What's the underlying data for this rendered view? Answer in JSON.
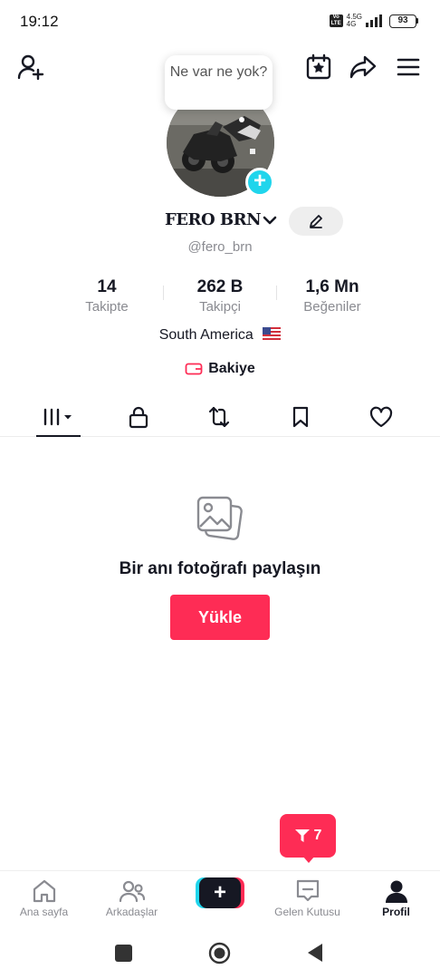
{
  "status_bar": {
    "time": "19:12",
    "volte": "Vo LTE",
    "network_top": "4.5G",
    "network_bottom": "4G",
    "battery": "93"
  },
  "header": {
    "add_friend_icon": "person-plus-icon",
    "calendar_icon": "calendar-star-icon",
    "share_icon": "share-arrow-icon",
    "menu_icon": "hamburger-menu-icon"
  },
  "profile": {
    "note_bubble": "Ne var ne yok?",
    "avatar_add": "+",
    "display_name": "FERO BRN",
    "username": "@fero_brn",
    "bio": "South America",
    "balance_label": "Bakiye"
  },
  "stats": [
    {
      "value": "14",
      "label": "Takipte"
    },
    {
      "value": "262 B",
      "label": "Takipçi"
    },
    {
      "value": "1,6 Mn",
      "label": "Beğeniler"
    }
  ],
  "tabs": [
    {
      "icon": "grid-filter-icon",
      "active": true
    },
    {
      "icon": "lock-icon",
      "active": false
    },
    {
      "icon": "repost-icon",
      "active": false
    },
    {
      "icon": "bookmark-icon",
      "active": false
    },
    {
      "icon": "heart-icon",
      "active": false
    }
  ],
  "empty_state": {
    "icon": "photo-stack-icon",
    "title": "Bir anı fotoğrafı paylaşın",
    "button": "Yükle"
  },
  "inbox_badge": {
    "count": "7"
  },
  "bottom_nav": [
    {
      "label": "Ana sayfa",
      "icon": "home-icon",
      "active": false
    },
    {
      "label": "Arkadaşlar",
      "icon": "friends-icon",
      "active": false
    },
    {
      "label": "",
      "icon": "create-plus-icon",
      "active": false
    },
    {
      "label": "Gelen Kutusu",
      "icon": "inbox-icon",
      "active": false
    },
    {
      "label": "Profil",
      "icon": "profile-icon",
      "active": true
    }
  ],
  "create_symbol": "+",
  "colors": {
    "accent": "#fe2c55",
    "cyan": "#20d5ec",
    "text": "#161823",
    "muted": "#8a8b91"
  }
}
